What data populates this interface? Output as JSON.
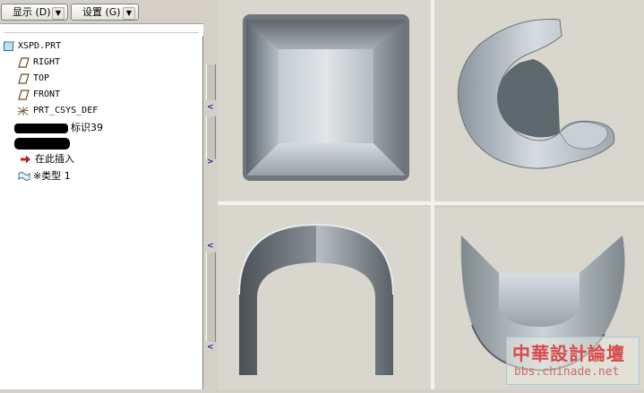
{
  "toolbar": {
    "display_label": "显示 (D)",
    "settings_label": "设置 (G)",
    "dropdown_glyph": "▼"
  },
  "model_tree": {
    "root": "XSPD.PRT",
    "items": [
      {
        "label": "RIGHT",
        "icon": "datum-plane-icon"
      },
      {
        "label": "TOP",
        "icon": "datum-plane-icon"
      },
      {
        "label": "FRONT",
        "icon": "datum-plane-icon"
      },
      {
        "label": "PRT_CSYS_DEF",
        "icon": "coordinate-system-icon"
      },
      {
        "label": "标识39",
        "icon": "feature-icon"
      },
      {
        "label": "在此插入",
        "icon": "insert-here-arrow-icon"
      },
      {
        "label": "※类型 1",
        "icon": "surface-feature-icon"
      }
    ]
  },
  "colors": {
    "viewport_bg": "#d8d6cd",
    "window_bg": "#d4d0c8",
    "tree_bg": "#ffffff",
    "splitter_arrow": "#1a2aa0",
    "watermark_red": "#d84a4a"
  },
  "watermark": {
    "title": "中華設計論壇",
    "url": "bbs.chinade.net"
  }
}
